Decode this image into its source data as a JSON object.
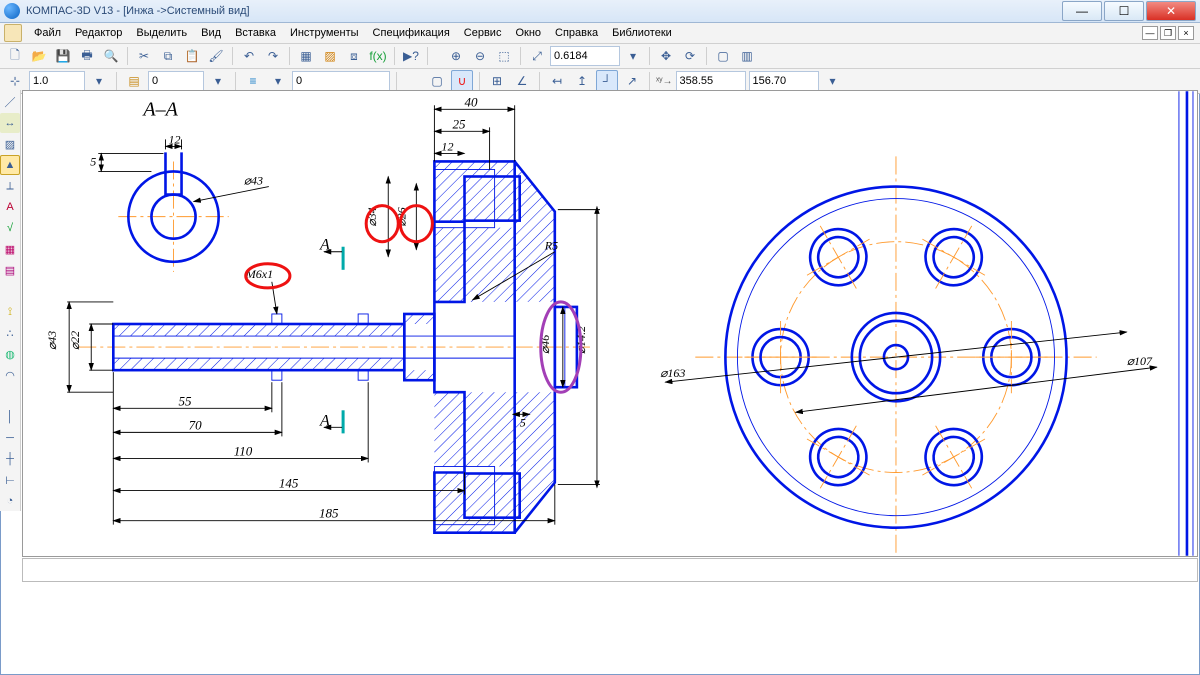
{
  "title": "КОМПАС-3D V13 - [Инжа ->Системный вид]",
  "menu": {
    "file": "Файл",
    "edit": "Редактор",
    "select": "Выделить",
    "view": "Вид",
    "insert": "Вставка",
    "tools": "Инструменты",
    "spec": "Спецификация",
    "service": "Сервис",
    "window": "Окно",
    "help": "Справка",
    "libs": "Библиотеки"
  },
  "toolbar": {
    "zoom": "0.6184",
    "scale": "1.0",
    "layer": "0",
    "ls": "0",
    "coordX": "358.55",
    "coordY": "156.70"
  },
  "section_label": "А–А",
  "section_mark": "А",
  "dims": {
    "d40": "40",
    "d25": "25",
    "d12a": "12",
    "d12b": "12",
    "d5a": "5",
    "d55": "55",
    "d70": "70",
    "d110": "110",
    "d145": "145",
    "d185": "185",
    "d5b": "5",
    "phi43a": "⌀43",
    "phi22": "⌀22",
    "phi43b": "⌀43",
    "phi34": "⌀34",
    "phi26": "⌀26",
    "phi46": "⌀46",
    "phi142": "⌀14.2",
    "phi163": "⌀163",
    "phi107": "⌀107",
    "r5": "R5",
    "m6x1": "M6x1"
  }
}
